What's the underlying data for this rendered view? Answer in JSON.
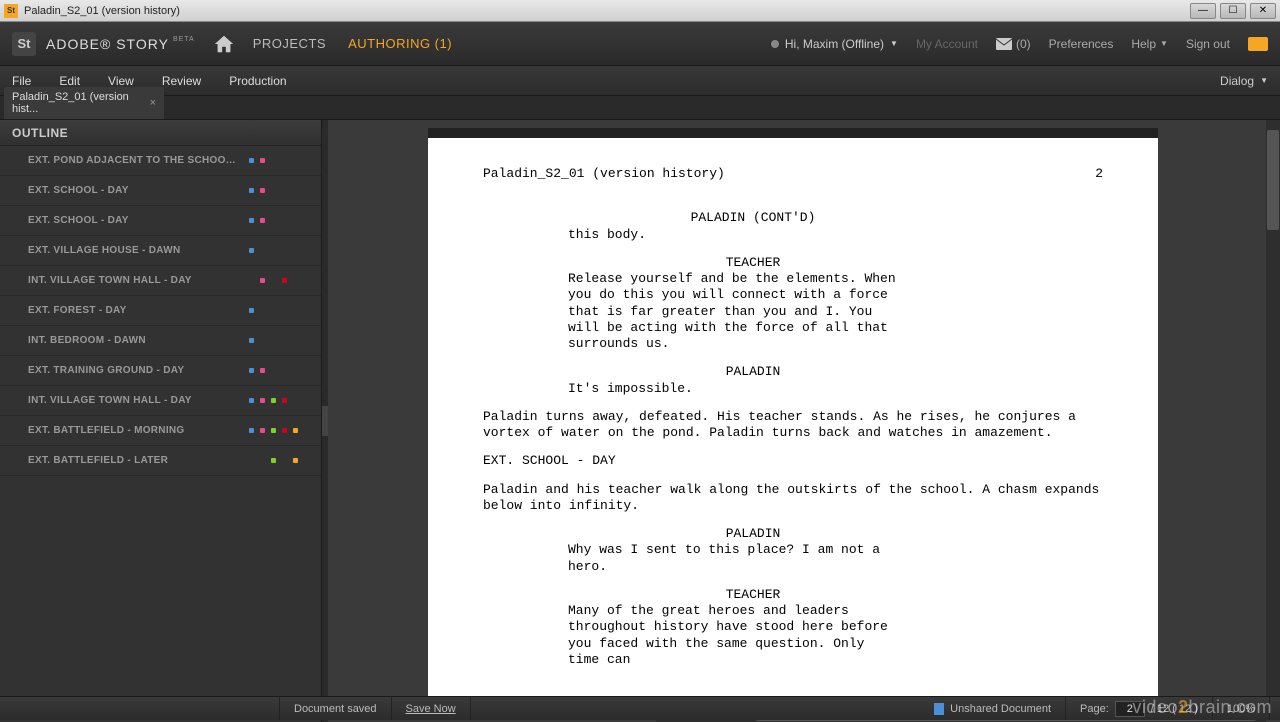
{
  "titlebar": {
    "icon": "St",
    "title": "Paladin_S2_01 (version history)"
  },
  "header": {
    "logo": "St",
    "brand": "ADOBE® STORY",
    "beta": "BETA",
    "nav": {
      "projects": "PROJECTS",
      "authoring": "AUTHORING (1)"
    },
    "user": "Hi, Maxim (Offline)",
    "my_account": "My Account",
    "msg_count": "(0)",
    "preferences": "Preferences",
    "help": "Help",
    "signout": "Sign out"
  },
  "menubar": {
    "file": "File",
    "edit": "Edit",
    "view": "View",
    "review": "Review",
    "production": "Production",
    "dialog": "Dialog"
  },
  "tab": {
    "label": "Paladin_S2_01 (version hist..."
  },
  "sidebar": {
    "title": "OUTLINE",
    "items": [
      {
        "label": "EXT. POND ADJACENT TO THE SCHOOL - ...",
        "colors": [
          "#4a90d9",
          "#e94b8a"
        ]
      },
      {
        "label": "EXT. SCHOOL - DAY",
        "colors": [
          "#4a90d9",
          "#e94b8a"
        ]
      },
      {
        "label": "EXT. SCHOOL - DAY",
        "colors": [
          "#4a90d9",
          "#e94b8a"
        ]
      },
      {
        "label": "EXT. VILLAGE HOUSE - DAWN",
        "colors": [
          "#4a90d9"
        ]
      },
      {
        "label": "INT. VILLAGE TOWN HALL - DAY",
        "colors": [
          "",
          "#e94b8a",
          "",
          "#d0021b"
        ]
      },
      {
        "label": "EXT. FOREST - DAY",
        "colors": [
          "#4a90d9"
        ]
      },
      {
        "label": "INT. BEDROOM - DAWN",
        "colors": [
          "#4a90d9"
        ]
      },
      {
        "label": "EXT. TRAINING GROUND - DAY",
        "colors": [
          "#4a90d9",
          "#e94b8a"
        ]
      },
      {
        "label": "INT. VILLAGE TOWN HALL - DAY",
        "colors": [
          "#4a90d9",
          "#e94b8a",
          "#7ed321",
          "#d0021b"
        ]
      },
      {
        "label": "EXT. BATTLEFIELD - MORNING",
        "colors": [
          "#4a90d9",
          "#e94b8a",
          "#7ed321",
          "#d0021b",
          "#f5a623"
        ]
      },
      {
        "label": "EXT. BATTLEFIELD - LATER",
        "colors": [
          "",
          "",
          "#7ed321",
          "",
          "#f5a623"
        ]
      }
    ]
  },
  "script": {
    "header_title": "Paladin_S2_01 (version history)",
    "page_num": "2",
    "blocks": [
      {
        "char": "PALADIN (CONT'D)",
        "dlg": "this body."
      },
      {
        "char": "TEACHER",
        "dlg": "Release yourself and be the elements. When you do this you will connect with a force that is far greater than you and I. You will be acting with the force of all that surrounds us."
      },
      {
        "char": "PALADIN",
        "dlg": "It's impossible."
      },
      {
        "action": "Paladin turns away, defeated. His teacher stands. As he rises, he conjures a vortex of water on the pond. Paladin turns back and watches in amazement."
      },
      {
        "scene": "EXT. SCHOOL - DAY"
      },
      {
        "action": "Paladin and his teacher walk along the outskirts of the school. A chasm expands below into infinity."
      },
      {
        "char": "PALADIN",
        "dlg": "Why was I sent to this place? I am not a hero."
      },
      {
        "char": "TEACHER",
        "dlg": "Many of the great heroes and leaders throughout history have stood here before you faced with the same question. Only time can"
      }
    ]
  },
  "status": {
    "saved": "Document saved",
    "save_now": "Save Now",
    "unshared": "Unshared Document",
    "page_label": "Page:",
    "page_current": "2",
    "page_total": "/ 12 ( 12 )",
    "zoom": "100%"
  },
  "watermark": {
    "pre": "video",
    "num": "2",
    "post": "brain.com"
  }
}
